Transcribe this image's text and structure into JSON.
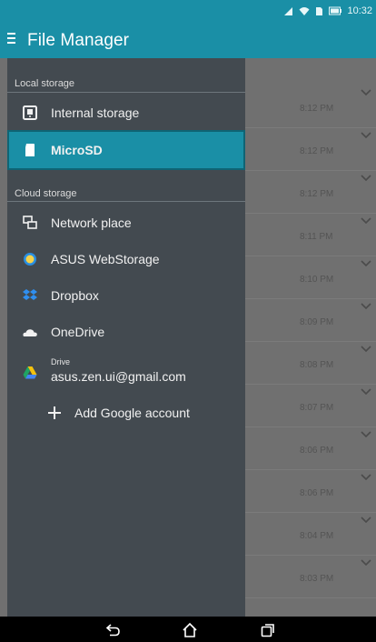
{
  "status": {
    "clock": "10:32",
    "icons": [
      "signal-icon",
      "wifi-icon",
      "sim-icon",
      "battery-icon"
    ]
  },
  "appbar": {
    "title": "File Manager"
  },
  "drawer": {
    "local_label": "Local storage",
    "local_items": [
      {
        "label": "Internal storage",
        "icon": "internal-storage-icon",
        "active": false
      },
      {
        "label": "MicroSD",
        "icon": "microsd-icon",
        "active": true
      }
    ],
    "cloud_label": "Cloud storage",
    "cloud_items": [
      {
        "label": "Network place",
        "icon": "network-place-icon"
      },
      {
        "label": "ASUS WebStorage",
        "icon": "asus-webstorage-icon"
      },
      {
        "label": "Dropbox",
        "icon": "dropbox-icon"
      },
      {
        "label": "OneDrive",
        "icon": "onedrive-icon"
      }
    ],
    "drive": {
      "title": "Drive",
      "account": "asus.zen.ui@gmail.com"
    },
    "add_account": "Add Google account"
  },
  "file_list": {
    "times": [
      "8:12 PM",
      "8:12 PM",
      "8:12 PM",
      "8:11 PM",
      "8:10 PM",
      "8:09 PM",
      "8:08 PM",
      "8:07 PM",
      "8:06 PM",
      "8:06 PM",
      "8:04 PM",
      "8:03 PM"
    ]
  },
  "nav": {
    "buttons": [
      "back-button",
      "home-button",
      "recents-button"
    ]
  },
  "colors": {
    "accent": "#1a8fa6",
    "drawer": "#434a50",
    "scrim": "#707070"
  }
}
